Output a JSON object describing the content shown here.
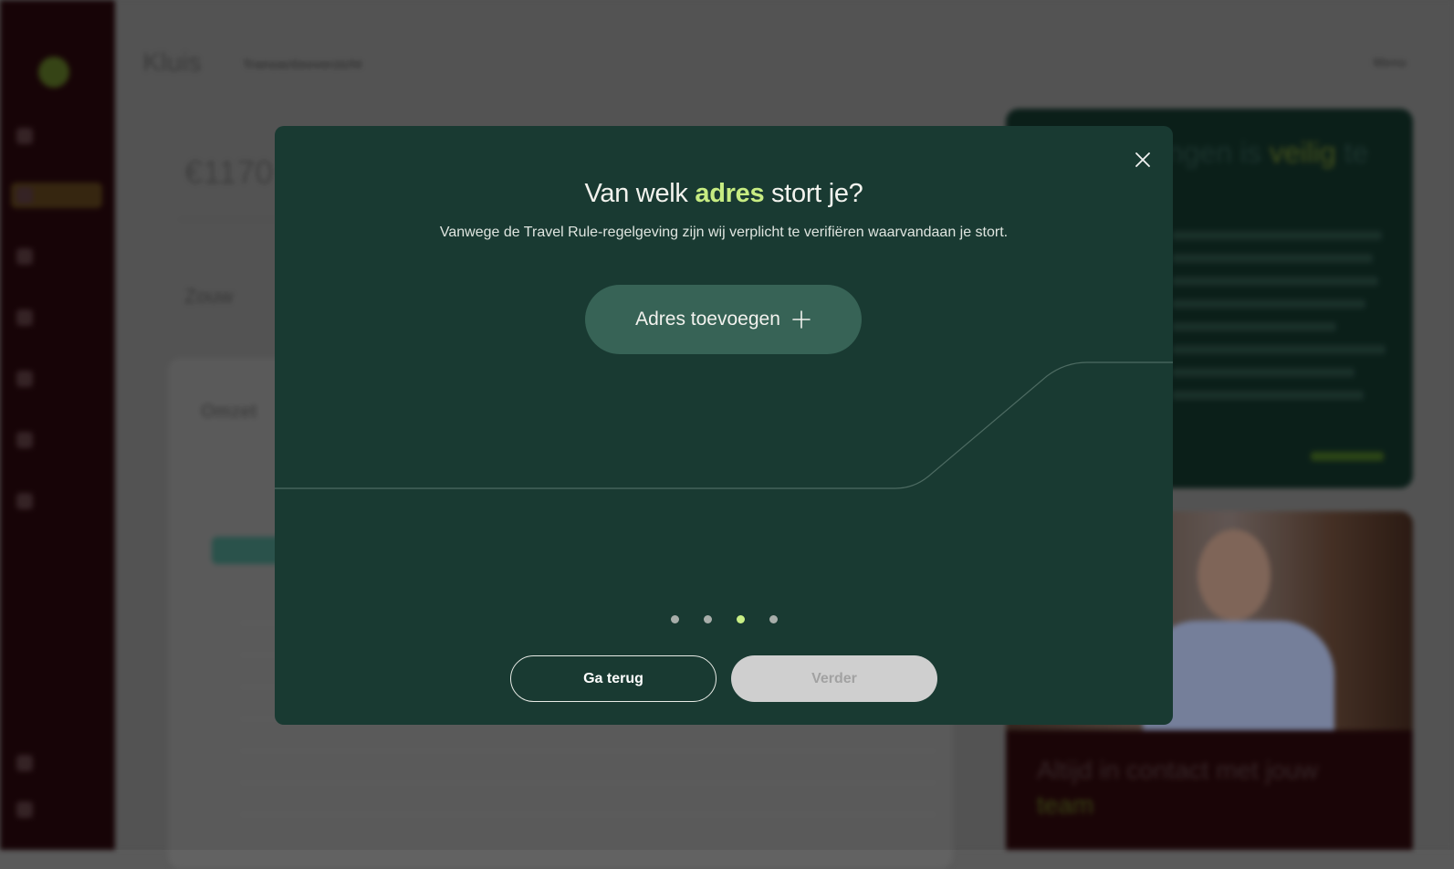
{
  "modal": {
    "title_before": "Van welk ",
    "title_highlight": "adres",
    "title_after": " stort je?",
    "subtitle": "Vanwege de Travel Rule-regelgeving zijn wij verplicht te verifiëren waarvandaan je stort.",
    "add_address_label": "Adres toevoegen",
    "steps_total": 4,
    "active_step": 3,
    "back_label": "Ga terug",
    "next_label": "Verder",
    "next_disabled": true
  },
  "background": {
    "app_title": "Kluis",
    "subtitle": "Transactieoverzicht",
    "menu_label": "Menu",
    "value": "€1170",
    "section_heading": "Zouw",
    "card_title": "Omzet",
    "side_card_title": "...ngen is ",
    "side_card_highlight": "veilig",
    "side_card_title_end": " te",
    "contact_title": "Altijd in contact met jouw",
    "contact_highlight": "team"
  },
  "icons": {
    "close": "close-icon",
    "add": "plus-icon"
  },
  "colors": {
    "modal_bg": "#193a32",
    "accent_green": "#c7ec82",
    "add_button_bg": "#376356",
    "disabled_button_bg": "#cfcfcf"
  }
}
